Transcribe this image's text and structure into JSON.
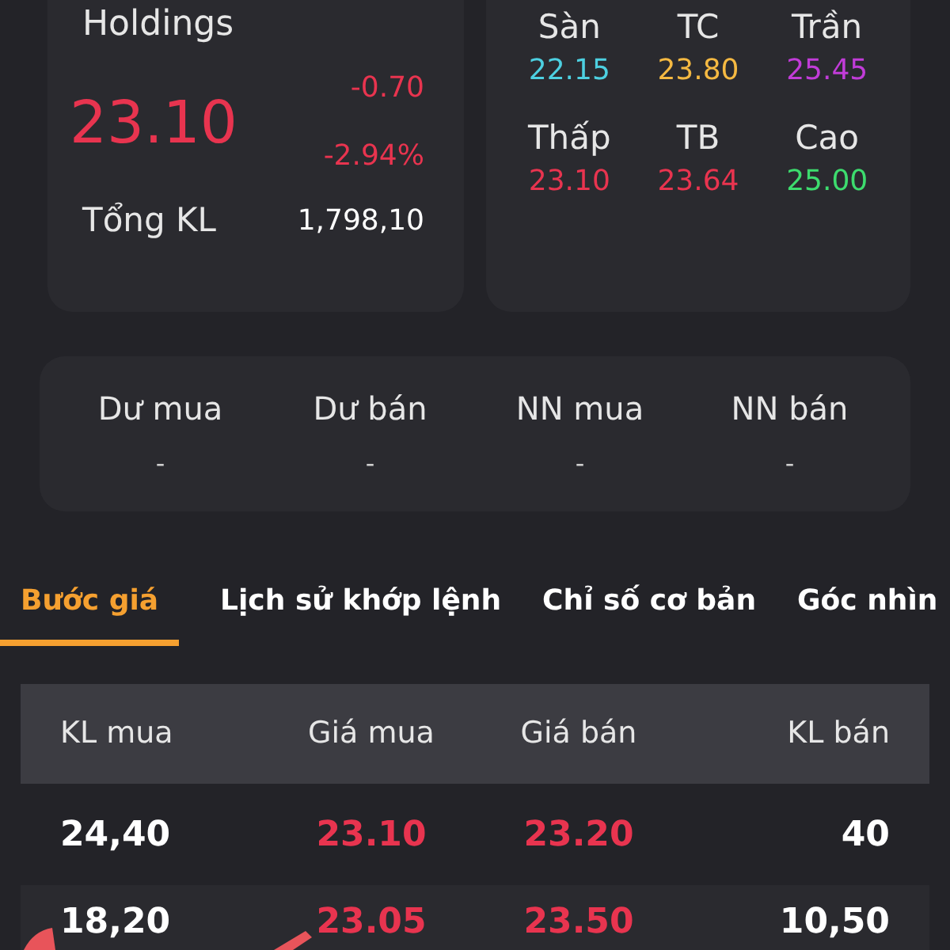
{
  "quote": {
    "name": "Holdings",
    "price": "23.10",
    "change": "-0.70",
    "change_pct": "-2.94%",
    "volume_label": "Tổng KL",
    "volume": "1,798,10"
  },
  "levels": [
    {
      "label": "Sàn",
      "value": "22.15",
      "color": "#4dd0e1"
    },
    {
      "label": "TC",
      "value": "23.80",
      "color": "#f5b942"
    },
    {
      "label": "Trần",
      "value": "25.45",
      "color": "#c13cd8"
    },
    {
      "label": "Thấp",
      "value": "23.10",
      "color": "#e8344f"
    },
    {
      "label": "TB",
      "value": "23.64",
      "color": "#e8344f"
    },
    {
      "label": "Cao",
      "value": "25.00",
      "color": "#3ddc6e"
    }
  ],
  "orders": [
    {
      "label": "Dư mua",
      "value": "-"
    },
    {
      "label": "Dư bán",
      "value": "-"
    },
    {
      "label": "NN mua",
      "value": "-"
    },
    {
      "label": "NN bán",
      "value": "-"
    }
  ],
  "tabs": [
    {
      "label": "Bước giá",
      "selected": true
    },
    {
      "label": "Lịch sử khớp lệnh",
      "selected": false
    },
    {
      "label": "Chỉ số cơ bản",
      "selected": false
    },
    {
      "label": "Góc nhìn",
      "selected": false
    }
  ],
  "table": {
    "columns": [
      "KL mua",
      "Giá mua",
      "Giá bán",
      "KL bán"
    ],
    "rows": [
      [
        "24,40",
        "23.10",
        "23.20",
        "40"
      ],
      [
        "18,20",
        "23.05",
        "23.50",
        "10,50"
      ]
    ]
  }
}
